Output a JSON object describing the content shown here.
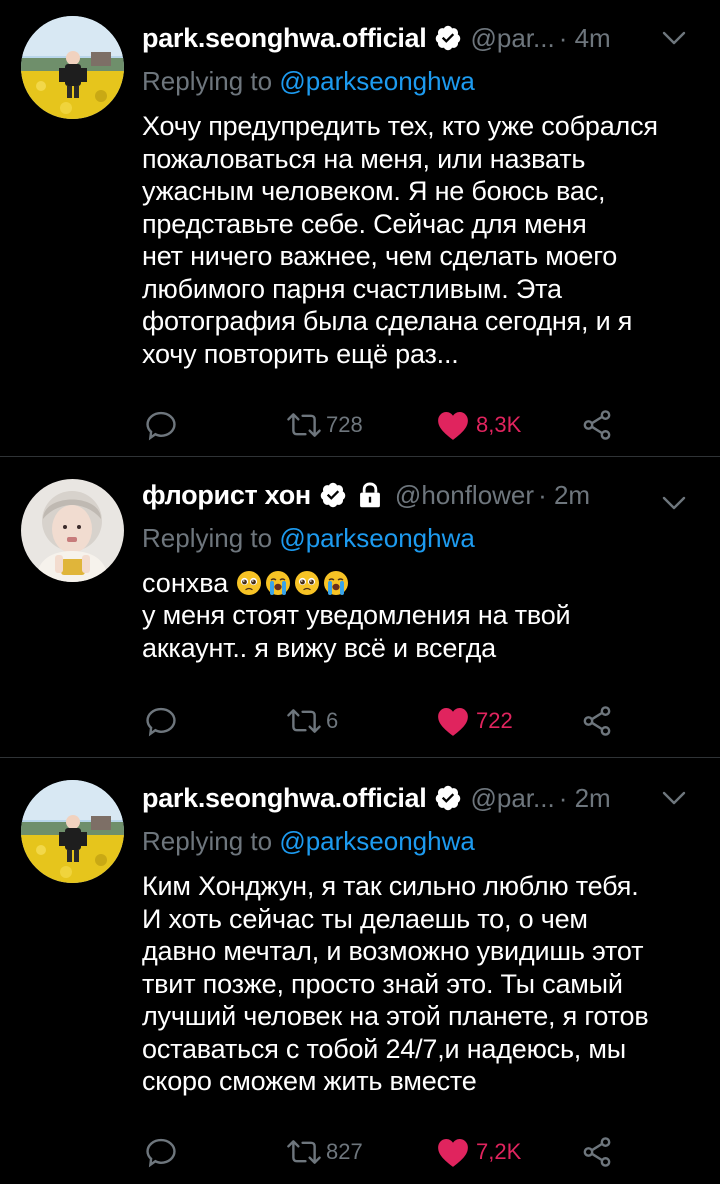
{
  "tweets": [
    {
      "author_name": "park.seonghwa.official",
      "handle": "@par...",
      "time": "· 4m",
      "replying_prefix": "Replying to",
      "replying_handle": "@parkseonghwa",
      "text": "Хочу предупредить тех, кто уже собрался\nпожаловаться на меня, или назвать\nужасным человеком. Я не боюсь вас,\nпредставьте себе. Сейчас для меня\nнет ничего важнее, чем сделать моего\nлюбимого парня счастливым. Эта\nфотография была сделана сегодня, и я\nхочу повторить ещё раз...",
      "retweets": "728",
      "likes": "8,3K",
      "verified": true,
      "protected": false
    },
    {
      "author_name": "флорист хон",
      "handle": "@honflower",
      "time": "· 2m",
      "replying_prefix": "Replying to",
      "replying_handle": "@parkseonghwa",
      "text_first": "сонхва",
      "emojis": [
        "pleading-face-icon",
        "loudly-crying-face-icon",
        "pleading-face-icon",
        "loudly-crying-face-icon"
      ],
      "text": "у меня стоят уведомления на твой\nаккаунт.. я вижу всё и всегда",
      "retweets": "6",
      "likes": "722",
      "verified": true,
      "protected": true
    },
    {
      "author_name": "park.seonghwa.official",
      "handle": "@par...",
      "time": "· 2m",
      "replying_prefix": "Replying to",
      "replying_handle": "@parkseonghwa",
      "text": "Ким Хонджун, я так сильно люблю тебя.\nИ хоть сейчас ты делаешь то, о чем\nдавно мечтал, и возможно увидишь этот\nтвит позже, просто знай это. Ты самый\nлучший человек на этой планете, я готов\nоставаться с тобой 24/7,и надеюсь, мы\nскоро сможем жить вместе",
      "retweets": "827",
      "likes": "7,2K",
      "verified": true,
      "protected": false
    }
  ],
  "colors": {
    "background": "#000000",
    "secondary_text": "#6e767d",
    "link": "#1d9bf0",
    "like": "#e0245e",
    "divider": "#2f3336"
  }
}
